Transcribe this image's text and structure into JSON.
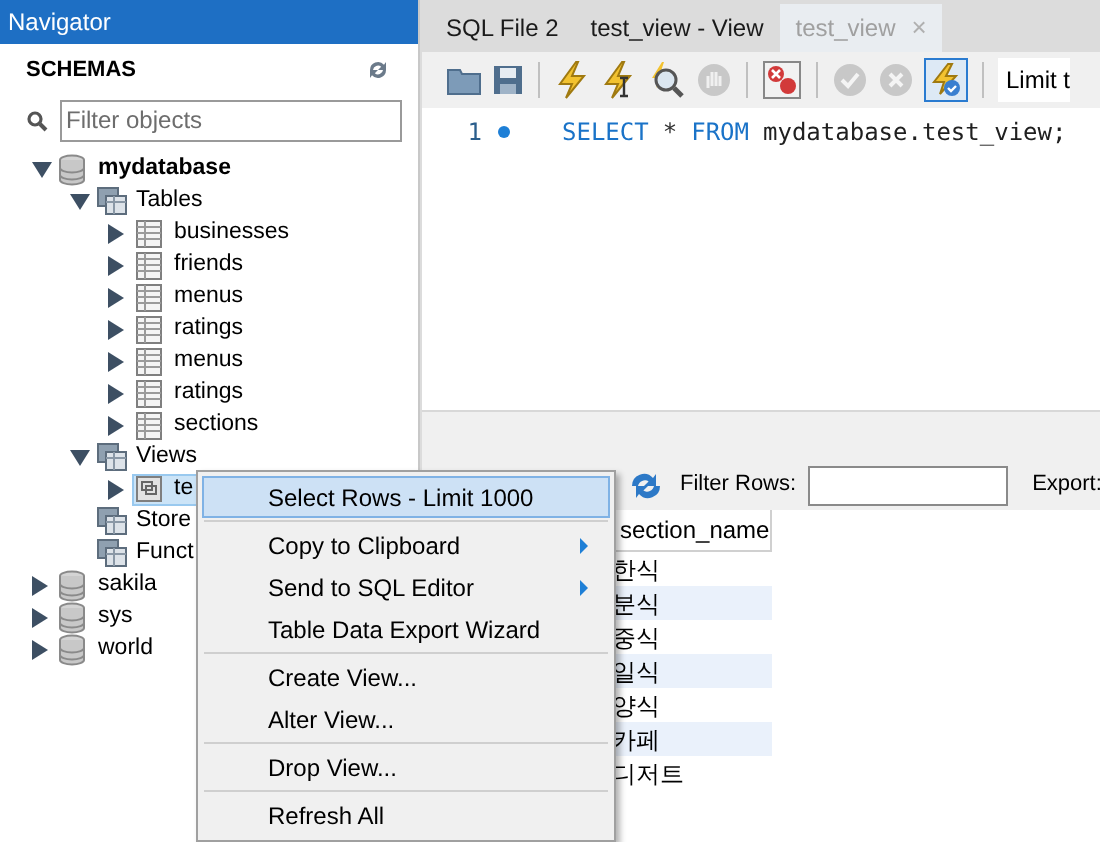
{
  "navigator": {
    "title": "Navigator",
    "section": "SCHEMAS",
    "filter": {
      "placeholder": "Filter objects"
    },
    "tree": [
      {
        "label": "mydatabase",
        "kind": "schema",
        "bold": true,
        "expanded": true,
        "selected": false,
        "children": [
          {
            "label": "Tables",
            "kind": "folder",
            "expanded": true,
            "selected": false,
            "children": [
              {
                "label": "businesses",
                "kind": "table",
                "expanded": false,
                "selected": false
              },
              {
                "label": "friends",
                "kind": "table",
                "expanded": false,
                "selected": false
              },
              {
                "label": "menus",
                "kind": "table",
                "expanded": false,
                "selected": false
              },
              {
                "label": "ratings",
                "kind": "table",
                "expanded": false,
                "selected": false
              },
              {
                "label": "menus",
                "kind": "table",
                "expanded": false,
                "selected": false
              },
              {
                "label": "ratings",
                "kind": "table",
                "expanded": false,
                "selected": false
              },
              {
                "label": "sections",
                "kind": "table",
                "expanded": false,
                "selected": false
              }
            ]
          },
          {
            "label": "Views",
            "kind": "folder",
            "expanded": true,
            "selected": false,
            "children": [
              {
                "label": "te",
                "kind": "view",
                "expanded": false,
                "selected": true
              }
            ]
          },
          {
            "label": "Store",
            "kind": "folder",
            "selected": false
          },
          {
            "label": "Funct",
            "kind": "folder",
            "selected": false
          }
        ]
      },
      {
        "label": "sakila",
        "kind": "schema",
        "bold": false,
        "expanded": false,
        "selected": false
      },
      {
        "label": "sys",
        "kind": "schema",
        "bold": false,
        "expanded": false,
        "selected": false
      },
      {
        "label": "world",
        "kind": "schema",
        "bold": false,
        "expanded": false,
        "selected": false
      }
    ]
  },
  "tabs": [
    {
      "label": "SQL File 2",
      "selected": false
    },
    {
      "label": "test_view - View",
      "selected": false
    },
    {
      "label": "test_view",
      "selected": true,
      "close": "×"
    }
  ],
  "toolbar": {
    "autocommit_selected": true,
    "limit_label": "Limit t"
  },
  "editor": {
    "lines": [
      {
        "number": "1",
        "marker": true,
        "tokens": [
          {
            "text": "SELECT",
            "kind": "keyword"
          },
          {
            "text": "*",
            "kind": "operator"
          },
          {
            "text": "FROM",
            "kind": "keyword"
          },
          {
            "text": "mydatabase.test_view;",
            "kind": "identifier"
          }
        ]
      }
    ]
  },
  "results": {
    "filter_label": "Filter Rows:",
    "export_label": "Export:",
    "column": "section_name",
    "rows": [
      "한식",
      "분식",
      "중식",
      "일식",
      "양식",
      "카페",
      "디저트"
    ]
  },
  "context_menu": [
    {
      "kind": "item",
      "label": "Select Rows - Limit 1000",
      "selected": true,
      "submenu": false
    },
    {
      "kind": "separator"
    },
    {
      "kind": "item",
      "label": "Copy to Clipboard",
      "selected": false,
      "submenu": true
    },
    {
      "kind": "item",
      "label": "Send to SQL Editor",
      "selected": false,
      "submenu": true
    },
    {
      "kind": "item",
      "label": "Table Data Export Wizard",
      "selected": false,
      "submenu": false
    },
    {
      "kind": "separator"
    },
    {
      "kind": "item",
      "label": "Create View...",
      "selected": false,
      "submenu": false
    },
    {
      "kind": "item",
      "label": "Alter View...",
      "selected": false,
      "submenu": false
    },
    {
      "kind": "separator"
    },
    {
      "kind": "item",
      "label": "Drop View...",
      "selected": false,
      "submenu": false
    },
    {
      "kind": "separator"
    },
    {
      "kind": "item",
      "label": "Refresh All",
      "selected": false,
      "submenu": false
    }
  ]
}
